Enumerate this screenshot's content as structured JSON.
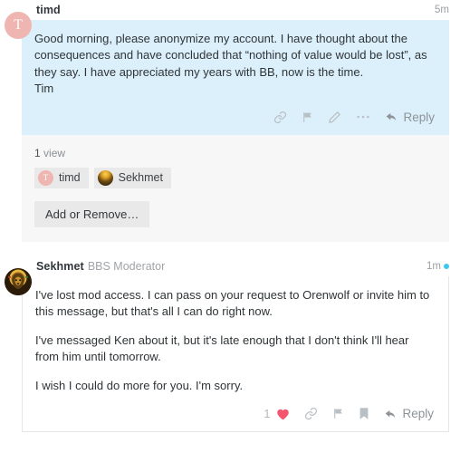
{
  "messages": [
    {
      "author": "timd",
      "author_title": "",
      "time": "5m",
      "unread": false,
      "avatar": {
        "type": "letter",
        "letter": "T",
        "color": "#efb5b0"
      },
      "paragraphs": [
        "Good morning, please anonymize my account. I have thought about the consequences and have concluded that “nothing of value would be lost”, as they say. I have appreciated my years with BB, now is the time.",
        "Tim"
      ],
      "actions": {
        "like_count": "",
        "reply_label": "Reply",
        "icons": [
          "link-icon",
          "flag-icon",
          "pencil-icon",
          "ellipsis-icon"
        ]
      }
    },
    {
      "author": "Sekhmet",
      "author_title": "BBS Moderator",
      "time": "1m",
      "unread": true,
      "avatar": {
        "type": "lion",
        "letter": "",
        "color": "#e0a326"
      },
      "paragraphs": [
        "I've lost mod access. I can pass on your request to Orenwolf or invite him to this message, but that's all I can do right now.",
        "I've messaged Ken about it, but it's late enough that I don't think I'll hear from him until tomorrow.",
        "I wish I could do more for you. I'm sorry."
      ],
      "actions": {
        "like_count": "1",
        "reply_label": "Reply",
        "icons": [
          "heart-icon",
          "link-icon",
          "flag-icon",
          "bookmark-icon"
        ]
      }
    }
  ],
  "participants_panel": {
    "views_count": "1",
    "views_label": "view",
    "chips": [
      {
        "name": "timd",
        "avatar_type": "letter",
        "avatar_letter": "T"
      },
      {
        "name": "Sekhmet",
        "avatar_type": "lion",
        "avatar_letter": ""
      }
    ],
    "add_remove_label": "Add or Remove…"
  },
  "colors": {
    "bubble_background": "#dcf0fc",
    "panel_background": "#f7f7f7",
    "heart": "#f3566e",
    "unread_dot": "#3ec6ef",
    "avatar_letter_bg": "#efb5b0"
  }
}
